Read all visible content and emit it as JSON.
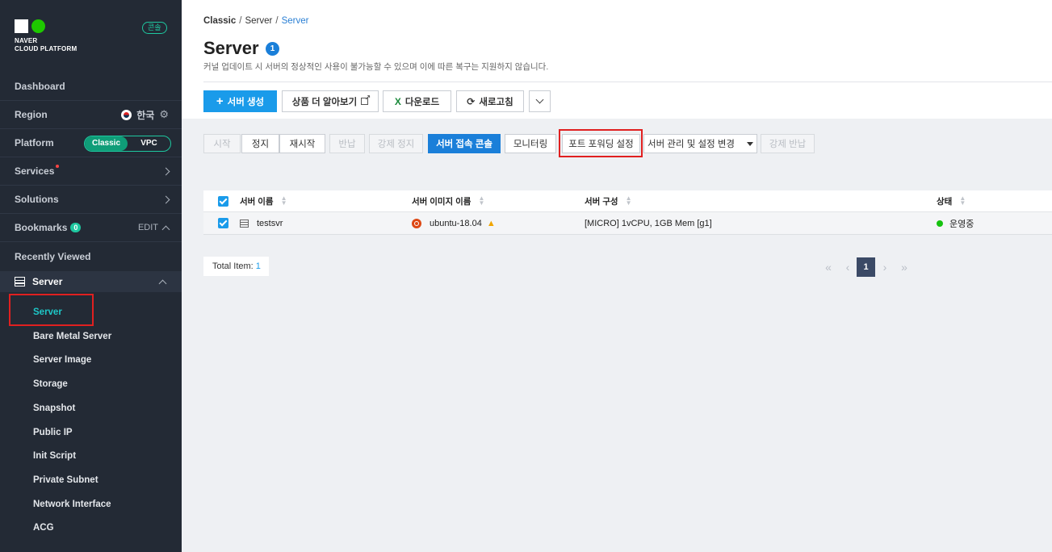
{
  "sidebar": {
    "logo_line1": "NAVER",
    "logo_line2": "CLOUD PLATFORM",
    "console_badge": "콘솔",
    "dashboard": "Dashboard",
    "region_label": "Region",
    "region_value": "한국",
    "platform_label": "Platform",
    "platform_options": [
      "Classic",
      "VPC"
    ],
    "platform_selected": "Classic",
    "services": "Services",
    "solutions": "Solutions",
    "bookmarks": "Bookmarks",
    "bookmarks_count": "0",
    "bookmarks_edit": "EDIT",
    "recently_viewed": "Recently Viewed",
    "server_group": "Server",
    "server_items": [
      "Server",
      "Bare Metal Server",
      "Server Image",
      "Storage",
      "Snapshot",
      "Public IP",
      "Init Script",
      "Private Subnet",
      "Network Interface",
      "ACG"
    ],
    "active_item": "Server"
  },
  "breadcrumb": [
    "Classic",
    "Server",
    "Server"
  ],
  "page": {
    "title": "Server",
    "count": "1",
    "subtitle": "커널 업데이트 시 서버의 정상적인 사용이 불가능할 수 있으며 이에 따른 복구는 지원하지 않습니다."
  },
  "toolbar": {
    "create": "서버 생성",
    "learn_more": "상품 더 알아보기",
    "download": "다운로드",
    "refresh": "새로고침"
  },
  "actions": {
    "start": "시작",
    "stop": "정지",
    "restart": "재시작",
    "return": "반납",
    "force_stop": "강제 정지",
    "console": "서버 접속 콘솔",
    "monitoring": "모니터링",
    "port_forwarding": "포트 포워딩 설정",
    "manage": "서버 관리 및 설정 변경",
    "force_return": "강제 반납"
  },
  "table": {
    "headers": [
      "서버 이름",
      "서버 이미지 이름",
      "서버 구성",
      "상태"
    ],
    "rows": [
      {
        "name": "testsvr",
        "image": "ubuntu-18.04",
        "spec": "[MICRO] 1vCPU, 1GB Mem [g1]",
        "status": "운영중"
      }
    ]
  },
  "footer": {
    "total_label": "Total Item:",
    "total_value": "1",
    "current_page": "1"
  },
  "colors": {
    "sidebar_bg": "#232a35",
    "accent": "#1a9bea",
    "highlight_box": "#e02020",
    "status_running": "#16c20f"
  }
}
